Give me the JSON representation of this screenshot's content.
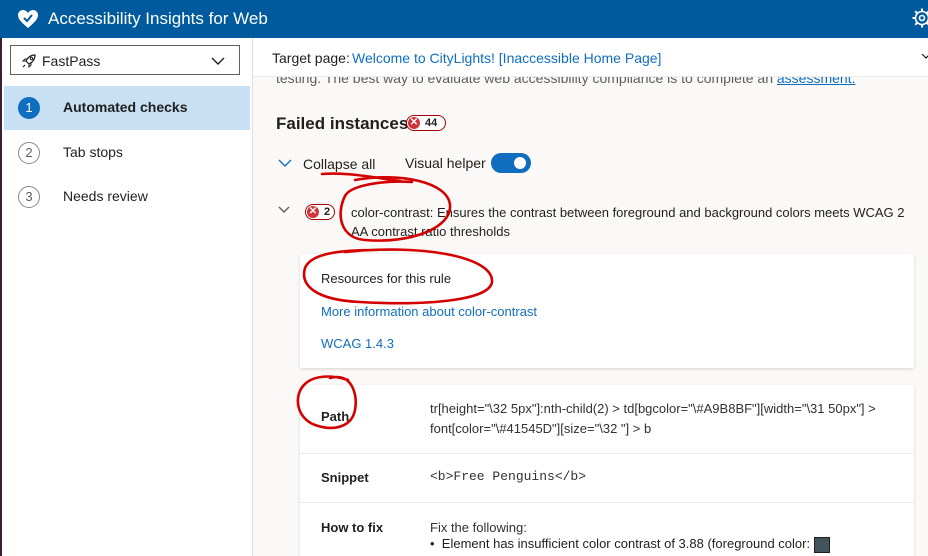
{
  "app": {
    "title": "Accessibility Insights for Web",
    "brand_color": "#005a9e"
  },
  "icons": {
    "logo": "heart-logo-icon",
    "settings": "gear-icon",
    "mode": "rocket-icon",
    "dropdown": "chevron-down-icon"
  },
  "sidebar": {
    "mode_select": {
      "value": "FastPass"
    },
    "items": [
      {
        "number": "1",
        "label": "Automated checks",
        "selected": true
      },
      {
        "number": "2",
        "label": "Tab stops",
        "selected": false
      },
      {
        "number": "3",
        "label": "Needs review",
        "selected": false
      }
    ]
  },
  "target": {
    "label": "Target page:",
    "link": "Welcome to CityLights! [Inaccessible Home Page]"
  },
  "main": {
    "intro_text": "testing. The best way to evaluate web accessibility compliance is to complete an ",
    "intro_link": "assessment.",
    "failed_title": "Failed instances",
    "failed_count": "44",
    "collapse_label": "Collapse all",
    "visual_helper_label": "Visual helper",
    "visual_helper_on": true,
    "rule": {
      "count": "2",
      "text": "color-contrast: Ensures the contrast between foreground and background colors meets WCAG 2 AA contrast ratio thresholds"
    },
    "resources": {
      "title": "Resources for this rule",
      "more_info": "More information about color-contrast",
      "wcag": "WCAG 1.4.3"
    },
    "instance": {
      "path_label": "Path",
      "path_value": "tr[height=\"\\32 5px\"]:nth-child(2) > td[bgcolor=\"\\#A9B8BF\"][width=\"\\31 50px\"] > font[color=\"\\#41545D\"][size=\"\\32 \"] > b",
      "snippet_label": "Snippet",
      "snippet_value": "<b>Free Penguins</b>",
      "howto_label": "How to fix",
      "howto_intro": "Fix the following:",
      "howto_item": "Element has insufficient color contrast of 3.88 (foreground color:",
      "swatch_color": "#41545d"
    }
  }
}
